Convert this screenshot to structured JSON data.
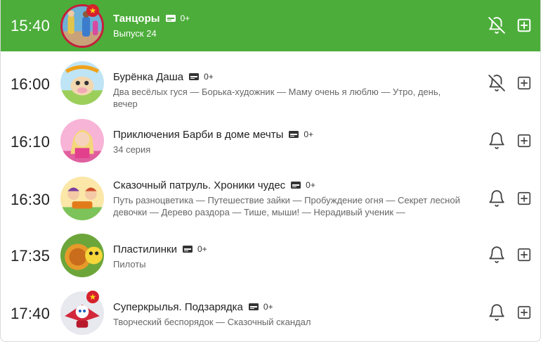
{
  "colors": {
    "active_row": "#4cad3a",
    "text": "#222222",
    "muted": "#666666",
    "badge": "#d6202c"
  },
  "programs": [
    {
      "time": "15:40",
      "title": "Танцоры",
      "age": "0+",
      "description": "Выпуск 24",
      "active": true,
      "bell": "bell-off-icon",
      "badge": "star"
    },
    {
      "time": "16:00",
      "title": "Бурёнка Даша",
      "age": "0+",
      "description": "Два весёлых гуся — Борька-художник — Маму очень я люблю — Утро, день, вечер",
      "bell": "bell-off-icon"
    },
    {
      "time": "16:10",
      "title": "Приключения Барби в доме мечты",
      "age": "0+",
      "description": "34 серия",
      "bell": "bell-icon"
    },
    {
      "time": "16:30",
      "title": "Сказочный патруль. Хроники чудес",
      "age": "0+",
      "description": "Путь разноцветика — Путешествие зайки — Пробуждение огня — Секрет лесной девочки — Дерево раздора — Тише, мыши! — Нерадивый ученик — Волшебные…",
      "bell": "bell-icon"
    },
    {
      "time": "17:35",
      "title": "Пластилинки",
      "age": "0+",
      "description": "Пилоты",
      "bell": "bell-icon"
    },
    {
      "time": "17:40",
      "title": "Суперкрылья. Подзарядка",
      "age": "0+",
      "description": "Творческий беспорядок — Сказочный скандал",
      "bell": "bell-icon",
      "badge": "star"
    }
  ]
}
